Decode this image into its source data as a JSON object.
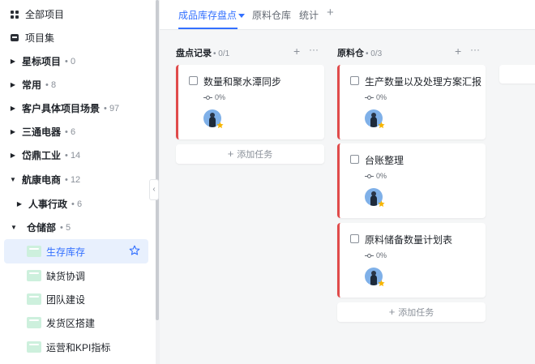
{
  "sidebar": {
    "all_projects": "全部项目",
    "project_set": "项目集",
    "groups": [
      {
        "name": "星标项目",
        "count": "0"
      },
      {
        "name": "常用",
        "count": "8"
      },
      {
        "name": "客户具体项目场景",
        "count": "97"
      },
      {
        "name": "三通电器",
        "count": "6"
      },
      {
        "name": "岱鼎工业",
        "count": "14"
      },
      {
        "name": "航康电商",
        "count": "12"
      },
      {
        "name": "人事行政",
        "count": "6"
      },
      {
        "name": "仓储部",
        "count": "5"
      }
    ],
    "leaves": [
      {
        "name": "生存库存"
      },
      {
        "name": "缺货协调"
      },
      {
        "name": "团队建设"
      },
      {
        "name": "发货区搭建"
      },
      {
        "name": "运营和KPI指标"
      }
    ]
  },
  "tabs": {
    "items": [
      {
        "label": "成品库存盘点"
      },
      {
        "label": "原料仓库"
      },
      {
        "label": "统计"
      }
    ],
    "add": "+"
  },
  "columns": [
    {
      "title": "盘点记录",
      "count": "• 0/1",
      "cards": [
        {
          "title": "数量和聚水潭同步",
          "progress": "0%"
        }
      ],
      "add_task": "添加任务"
    },
    {
      "title": "原料仓",
      "count": "• 0/3",
      "cards": [
        {
          "title": "生产数量以及处理方案汇报",
          "progress": "0%"
        },
        {
          "title": "台账整理",
          "progress": "0%"
        },
        {
          "title": "原料储备数量计划表",
          "progress": "0%"
        }
      ],
      "add_task": "添加任务"
    }
  ],
  "common": {
    "plus": "+",
    "more": "···",
    "dot": "•",
    "collapse": "‹"
  },
  "colors": {
    "accent": "#3370ff",
    "card_border": "#e04b4b",
    "active_bg": "#e8f0fd",
    "leaf_icon": "#cdf0dd"
  }
}
